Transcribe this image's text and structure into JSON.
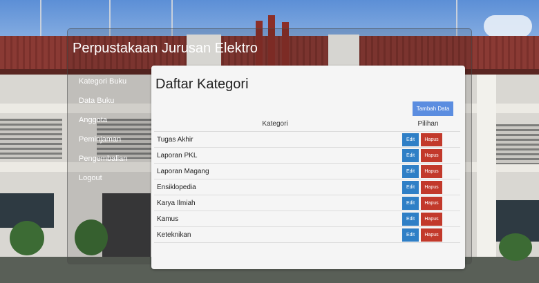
{
  "app": {
    "title": "Perpustakaan Jurusan Elektro"
  },
  "sidebar": {
    "items": [
      {
        "label": "Kategori Buku"
      },
      {
        "label": "Data Buku"
      },
      {
        "label": "Anggota"
      },
      {
        "label": "Peminjaman"
      },
      {
        "label": "Pengembalian"
      },
      {
        "label": "Logout"
      }
    ]
  },
  "main": {
    "title": "Daftar Kategori",
    "add_label": "Tambah Data",
    "columns": [
      "Kategori",
      "Pilihan"
    ],
    "rows": [
      {
        "name": "Tugas Akhir"
      },
      {
        "name": "Laporan PKL"
      },
      {
        "name": "Laporan Magang"
      },
      {
        "name": "Ensiklopedia"
      },
      {
        "name": "Karya Ilmiah"
      },
      {
        "name": "Kamus"
      },
      {
        "name": "Keteknikan"
      }
    ],
    "edit_label": "Edit",
    "delete_label": "Hapus"
  },
  "colors": {
    "add_button": "#5b8de0",
    "edit_button": "#2f7fc6",
    "delete_button": "#c2392b"
  }
}
